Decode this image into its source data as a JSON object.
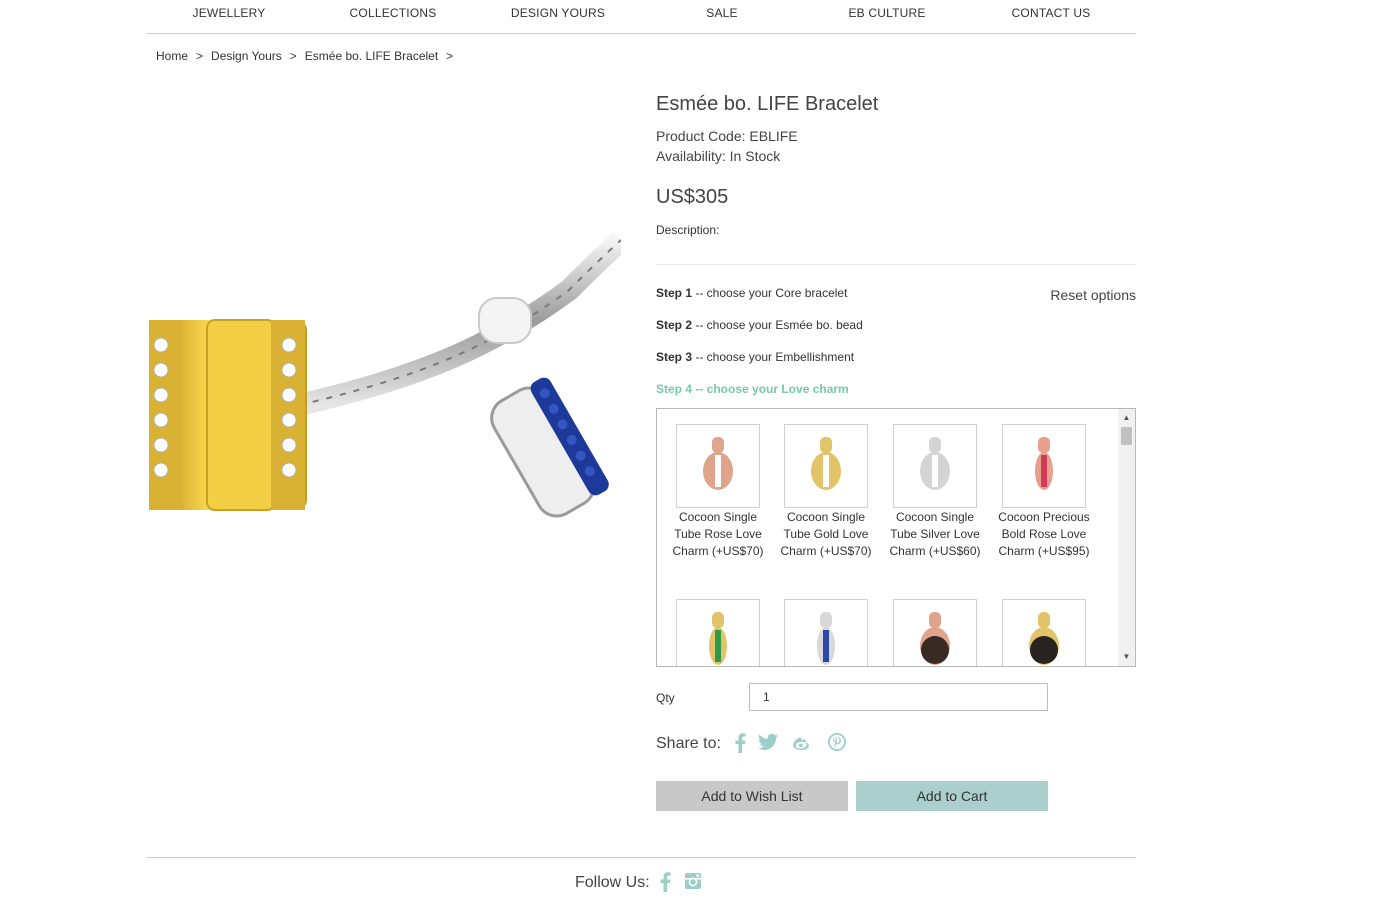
{
  "nav": {
    "items": [
      "JEWELLERY",
      "COLLECTIONS",
      "DESIGN YOURS",
      "SALE",
      "EB CULTURE",
      "CONTACT US"
    ]
  },
  "breadcrumb": {
    "items": [
      "Home",
      "Design Yours",
      "Esmée bo. LIFE Bracelet"
    ],
    "separator": ">"
  },
  "product": {
    "title": "Esmée bo. LIFE Bracelet",
    "code": "Product Code: EBLIFE",
    "availability": "Availability: In Stock",
    "price": "US$305",
    "description_label": "Description:"
  },
  "steps": [
    {
      "bold": "Step 1",
      "text": " -- choose your Core bracelet"
    },
    {
      "bold": "Step 2",
      "text": " -- choose your Esmée bo. bead"
    },
    {
      "bold": "Step 3",
      "text": " -- choose your Embellishment"
    },
    {
      "bold": "Step 4 -- choose your Love charm",
      "text": ""
    }
  ],
  "reset_label": "Reset options",
  "charms": [
    {
      "name": "Cocoon Single Tube Rose Love Charm (+US$70)",
      "metal": "#e0a48c",
      "accent": "#ffffff"
    },
    {
      "name": "Cocoon Single Tube Gold Love Charm (+US$70)",
      "metal": "#e2c36a",
      "accent": "#ffffff"
    },
    {
      "name": "Cocoon Single Tube Silver Love Charm (+US$60)",
      "metal": "#d4d4d4",
      "accent": "#ffffff"
    },
    {
      "name": "Cocoon Precious Bold Rose Love Charm (+US$95)",
      "metal": "#e8a08c",
      "accent": "#d23a5a"
    },
    {
      "name": "",
      "metal": "#e2c36a",
      "accent": "#2f9a4a"
    },
    {
      "name": "",
      "metal": "#d8d8d8",
      "accent": "#2a4aa8"
    },
    {
      "name": "",
      "metal": "#e0a48c",
      "accent": "#3a2a24"
    },
    {
      "name": "",
      "metal": "#e2c36a",
      "accent": "#2a2420"
    }
  ],
  "qty": {
    "label": "Qty",
    "value": "1"
  },
  "share": {
    "label": "Share to:",
    "icons": [
      "facebook-icon",
      "twitter-icon",
      "weibo-icon",
      "pinterest-icon"
    ]
  },
  "buttons": {
    "wishlist": "Add to Wish List",
    "cart": "Add to Cart"
  },
  "footer": {
    "follow_label": "Follow Us:",
    "icons": [
      "facebook-icon",
      "instagram-icon"
    ]
  },
  "colors": {
    "accent": "#7ac7b0",
    "cart_button": "#abcfcd",
    "wish_button": "#c8c8c8",
    "icon": "#9bcfc8"
  }
}
